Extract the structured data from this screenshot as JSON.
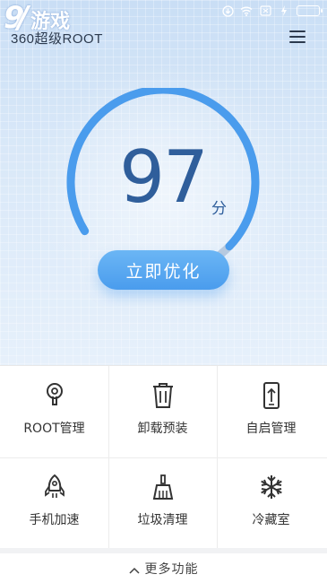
{
  "watermark": {
    "number": "9",
    "text": "游戏"
  },
  "header": {
    "app_title": "360超级ROOT",
    "menu_icon": "hamburger-menu-icon"
  },
  "status_bar": {
    "icons": [
      "download-icon",
      "wifi-icon",
      "sim-icon",
      "charge-icon",
      "battery-icon"
    ],
    "battery_level": 1.0
  },
  "score": {
    "value": "97",
    "unit": "分",
    "progress": 0.97
  },
  "optimize_button": {
    "label": "立即优化"
  },
  "features": [
    {
      "label": "ROOT管理",
      "icon": "keyhole-icon"
    },
    {
      "label": "卸载预装",
      "icon": "trash-icon"
    },
    {
      "label": "自启管理",
      "icon": "phone-upload-icon"
    },
    {
      "label": "手机加速",
      "icon": "rocket-icon"
    },
    {
      "label": "垃圾清理",
      "icon": "broom-icon"
    },
    {
      "label": "冷藏室",
      "icon": "snowflake-icon"
    }
  ],
  "more": {
    "label": "更多功能",
    "icon": "chevron-up-icon"
  },
  "colors": {
    "accent": "#4a9ced",
    "score_text": "#2f5e9b",
    "hero_bg": "#d9e8f8"
  }
}
